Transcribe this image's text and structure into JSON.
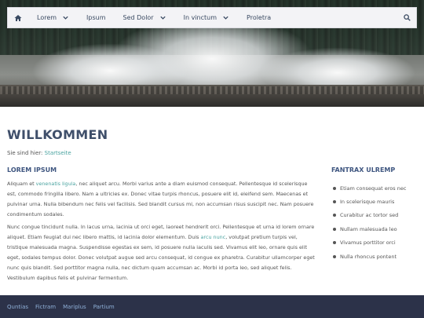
{
  "nav": {
    "items": [
      {
        "label": "Lorem",
        "dropdown": true
      },
      {
        "label": "Ipsum",
        "dropdown": false
      },
      {
        "label": "Sed Dolor",
        "dropdown": true
      },
      {
        "label": "In vinctum",
        "dropdown": true
      },
      {
        "label": "Proletra",
        "dropdown": false
      }
    ]
  },
  "page": {
    "title": "WILLKOMMEN",
    "breadcrumb_prefix": "Sie sind hier:",
    "breadcrumb_link": "Startseite"
  },
  "main": {
    "heading": "LOREM IPSUM",
    "p1_a": "Aliquam et ",
    "p1_link": "venenatis ligula",
    "p1_b": ", nec aliquet arcu. Morbi varius ante a diam euismod consequat. Pellentesque id scelerisque est, commodo fringilla libero. Nam a ultricies ex. Donec vitae turpis rhoncus, posuere elit id, eleifend sem. Maecenas et pulvinar urna. Nulla bibendum nec felis vel facilisis. Sed blandit cursus mi, non accumsan risus suscipit nec. Nam posuere condimentum sodales.",
    "p2_a": "Nunc congue tincidunt nulla. In lacus urna, lacinia ut orci eget, laoreet hendrerit orci. Pellentesque et urna id lorem ornare aliquet. Etiam feugiat dui nec libero mattis, id lacinia dolor elementum. Duis ",
    "p2_link": "arcu nunc",
    "p2_b": ", volutpat pretium turpis vel, tristique malesuada magna. Suspendisse egestas ex sem, id posuere nulla iaculis sed. Vivamus elit leo, ornare quis elit eget, sodales tempus dolor. Donec volutpat augue sed arcu consequat, id congue ex pharetra. Curabitur ullamcorper eget nunc quis blandit. Sed porttitor magna nulla, nec dictum quam accumsan ac. Morbi id porta leo, sed aliquet felis. Vestibulum dapibus felis et pulvinar fermentum."
  },
  "aside": {
    "heading": "FANTRAX ULREMP",
    "items": [
      "Etiam consequat eros nec",
      "In scelerisque mauris",
      "Curabitur ac tortor sed",
      "Nullam malesuada leo",
      "Vivamus porttitor orci",
      "Nulla rhoncus pontent"
    ]
  },
  "footer": {
    "links": [
      "Quntias",
      "Fictram",
      "Mariplus",
      "Partium"
    ]
  },
  "colors": {
    "footer_bg": "#2c3249",
    "link_accent": "#4aa3a0",
    "heading": "#3f4f6a"
  },
  "icons": {
    "home": "home-icon",
    "search": "search-icon",
    "chevron": "chevron-down-icon"
  }
}
